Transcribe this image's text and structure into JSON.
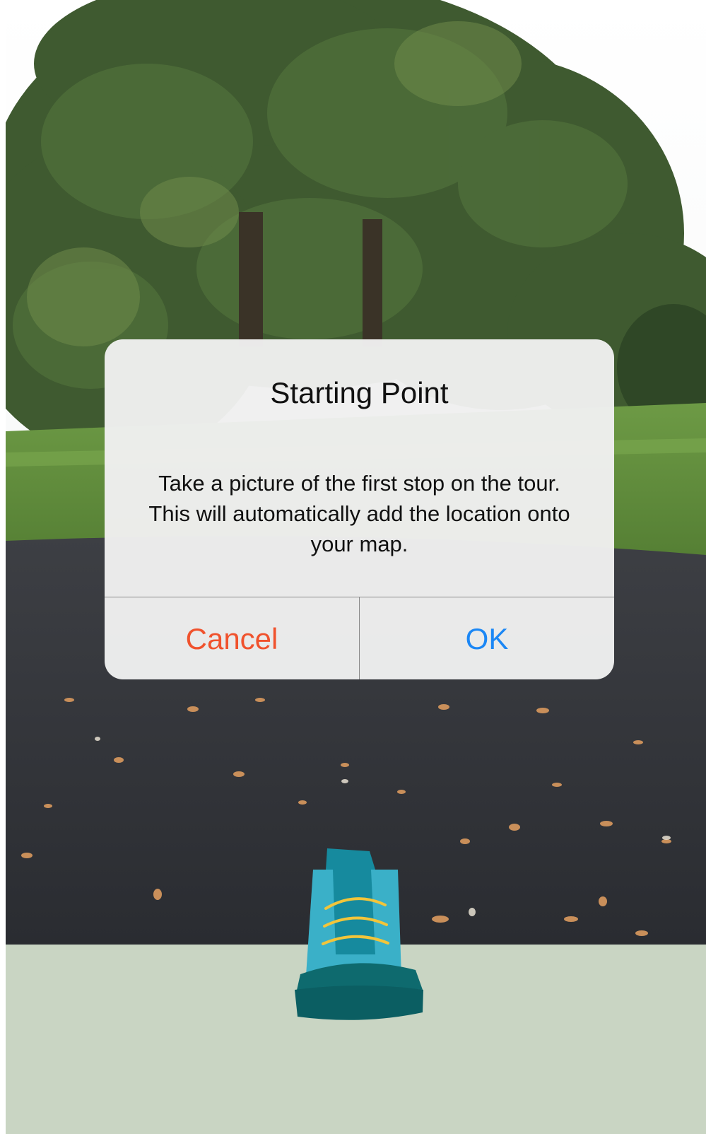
{
  "alert": {
    "title": "Starting Point",
    "message": "Take a picture of the first stop on the tour. This will automatically add the location onto your map.",
    "cancel_label": "Cancel",
    "ok_label": "OK"
  },
  "colors": {
    "cancel": "#f0522d",
    "ok": "#1b87f5",
    "bottom_panel": "#c9d5c3",
    "shoe_primary": "#3ab0c8",
    "shoe_dark": "#0b5e62",
    "laces": "#f2c53a"
  },
  "icons": {
    "capture_button": "hiking-boot-icon"
  }
}
